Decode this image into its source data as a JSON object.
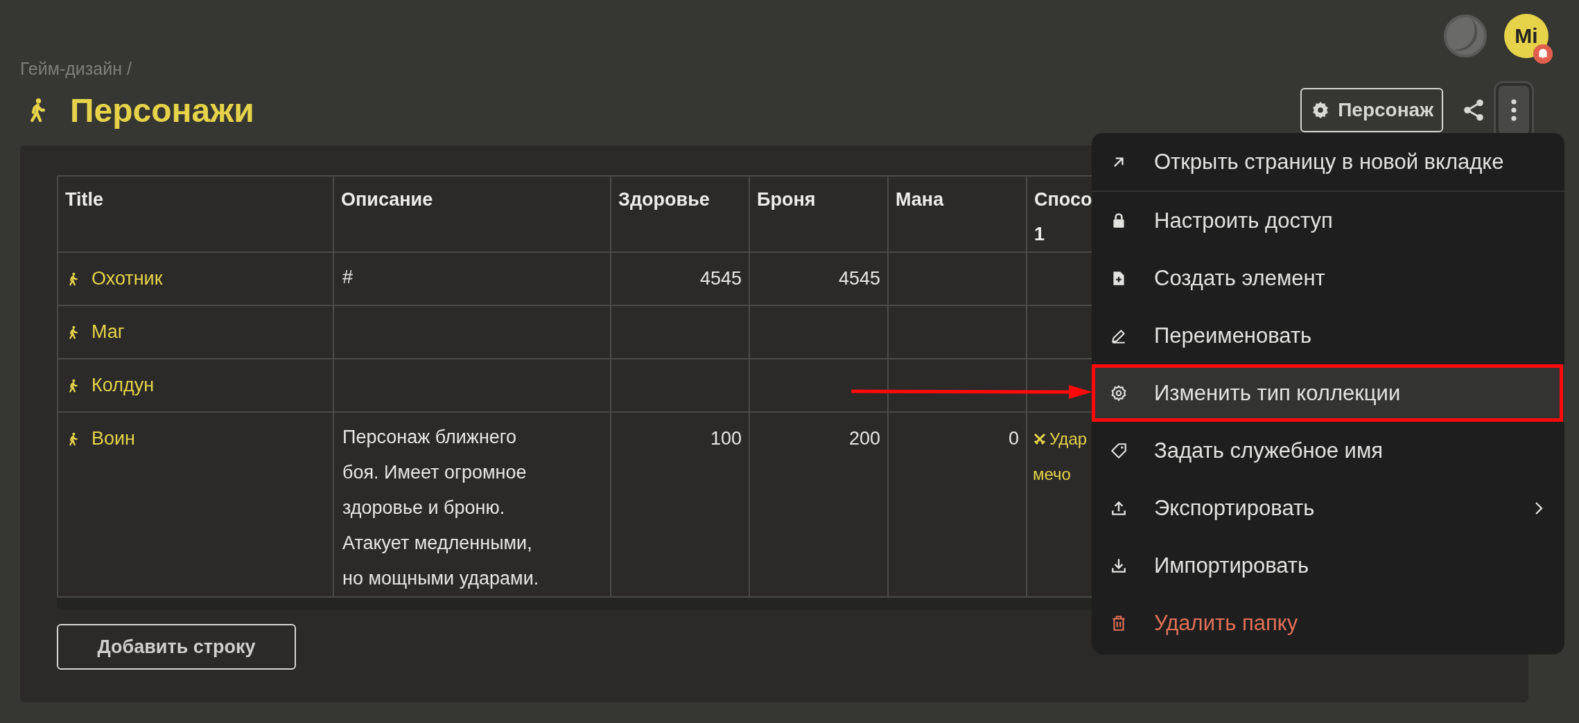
{
  "top_bar": {
    "avatar_initials": "Mi",
    "notification_badge": true
  },
  "breadcrumb": "Гейм-дизайн /",
  "title": "Персонажи",
  "toolbar": {
    "type_button": "Персонаж",
    "menu_open": true
  },
  "table": {
    "columns": [
      {
        "label": "Title"
      },
      {
        "label": "Описание"
      },
      {
        "label": "Здоровье"
      },
      {
        "label": "Броня"
      },
      {
        "label": "Мана"
      },
      {
        "label": "Спосо",
        "label_line2": "1"
      }
    ],
    "rows": [
      {
        "title": "Охотник",
        "description": "#",
        "health": "4545",
        "armor": "4545"
      },
      {
        "title": "Маг"
      },
      {
        "title": "Колдун"
      },
      {
        "title": "Воин",
        "description": "Персонаж ближнего боя. Имеет огромное здоровье и броню. Атакует медленными, но мощными ударами.",
        "health": "100",
        "armor": "200",
        "mana": "0",
        "ability_lines": [
          "Удар",
          "мечо"
        ]
      }
    ]
  },
  "add_row_button": "Добавить строку",
  "menu": {
    "items": [
      {
        "kind": "open-new-tab",
        "label": "Открыть страницу в новой вкладке",
        "highlighted": false,
        "danger": false,
        "submenu": false,
        "divider_after": true,
        "annotated": false
      },
      {
        "kind": "access",
        "label": "Настроить доступ",
        "highlighted": false,
        "danger": false,
        "submenu": false,
        "divider_after": false,
        "annotated": false
      },
      {
        "kind": "create",
        "label": "Создать элемент",
        "highlighted": false,
        "danger": false,
        "submenu": false,
        "divider_after": false,
        "annotated": false
      },
      {
        "kind": "rename",
        "label": "Переименовать",
        "highlighted": false,
        "danger": false,
        "submenu": false,
        "divider_after": false,
        "annotated": false
      },
      {
        "kind": "settings",
        "label": "Изменить тип коллекции",
        "highlighted": true,
        "danger": false,
        "submenu": false,
        "divider_after": false,
        "annotated": true
      },
      {
        "kind": "tag",
        "label": "Задать служебное имя",
        "highlighted": false,
        "danger": false,
        "submenu": false,
        "divider_after": false,
        "annotated": false
      },
      {
        "kind": "export",
        "label": "Экспортировать",
        "highlighted": false,
        "danger": false,
        "submenu": true,
        "divider_after": false,
        "annotated": false
      },
      {
        "kind": "import",
        "label": "Импортировать",
        "highlighted": false,
        "danger": false,
        "submenu": false,
        "divider_after": false,
        "annotated": false
      },
      {
        "kind": "delete",
        "label": "Удалить папку",
        "highlighted": false,
        "danger": true,
        "submenu": false,
        "divider_after": false,
        "annotated": false
      }
    ]
  }
}
